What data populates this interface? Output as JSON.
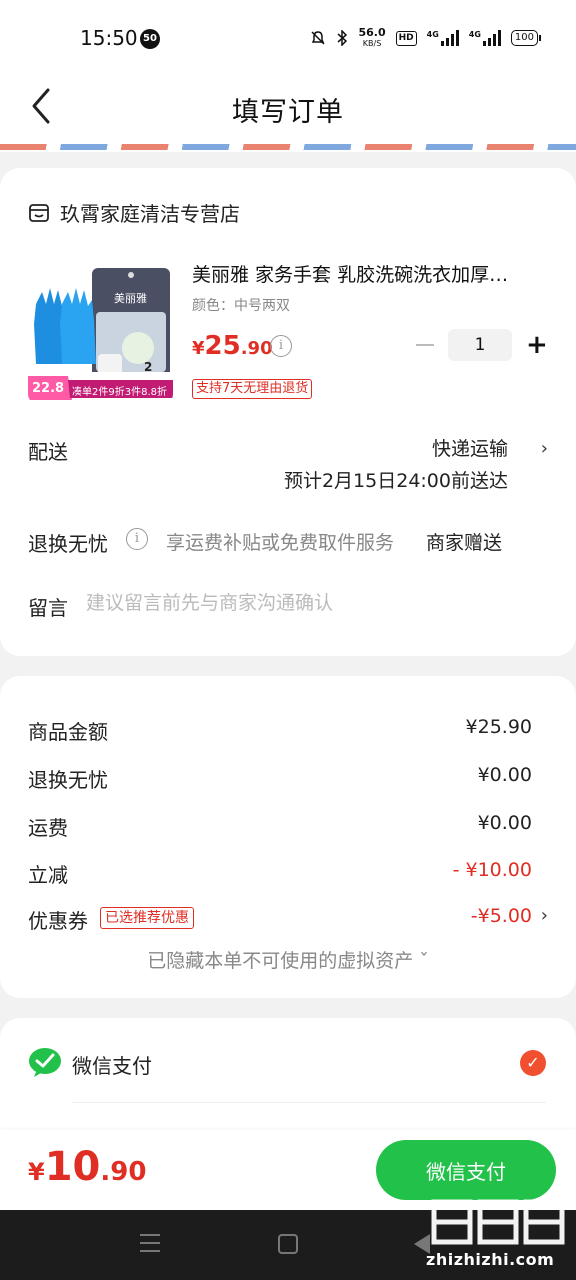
{
  "status_bar": {
    "time": "15:50",
    "notification_count": "50",
    "net_speed": "56.0",
    "net_unit": "KB/S",
    "hd_label": "HD",
    "signal1_label": "4G",
    "signal2_label": "4G",
    "battery": "100"
  },
  "header": {
    "title": "填写订单",
    "back_icon": "chevron-left-icon"
  },
  "order": {
    "shop_name": "玖霄家庭清洁专营店",
    "product": {
      "title": "美丽雅 家务手套 乳胶洗碗洗衣加厚…",
      "spec": "颜色：中号两双",
      "price_currency": "¥",
      "price_integer": "25",
      "price_decimal": ".90",
      "quantity": "1",
      "return_tag": "支持7天无理由退货",
      "image_banner_price": "22.8",
      "image_banner_text": "凑单2件9折3件8.8折",
      "image_brand": "美丽雅",
      "image_pack": "2"
    },
    "delivery": {
      "label": "配送",
      "method": "快递运输",
      "eta": "预计2月15日24:00前送达"
    },
    "worry_free": {
      "label": "退换无忧",
      "desc": "享运费补贴或免费取件服务",
      "gift": "商家赠送"
    },
    "remark": {
      "label": "留言",
      "placeholder": "建议留言前先与商家沟通确认"
    }
  },
  "summary": {
    "rows": [
      {
        "label": "商品金额",
        "value": "¥25.90"
      },
      {
        "label": "退换无忧",
        "value": "¥0.00"
      },
      {
        "label": "运费",
        "value": "¥0.00"
      },
      {
        "label": "立减",
        "value": "- ¥10.00"
      },
      {
        "label": "优惠券",
        "value": "-¥5.00",
        "tag": "已选推荐优惠"
      }
    ],
    "hidden_assets": "已隐藏本单不可使用的虚拟资产 ˇ"
  },
  "payment": {
    "method_label": "微信支付",
    "selected": true
  },
  "bottom": {
    "total_currency": "¥",
    "total_integer": "10",
    "total_decimal": ".90",
    "pay_button": "微信支付"
  },
  "watermark": "zhizhizhi.com",
  "colors": {
    "accent_red": "#e02e24",
    "pay_green": "#21c14a",
    "check_orange": "#f0502f"
  }
}
